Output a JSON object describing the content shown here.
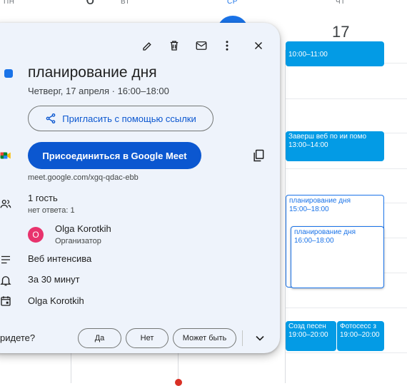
{
  "calendar": {
    "day_headers": [
      "ПН",
      "ВТ",
      "СР",
      "ЧТ"
    ],
    "day_number_partial": "6",
    "day_number": "17",
    "events": [
      {
        "title": "",
        "time": "10:00–11:00",
        "style": "solid"
      },
      {
        "title": "Заверш веб по ии помо",
        "time": "13:00–14:00",
        "style": "solid"
      },
      {
        "title": "планирование дня",
        "time": "15:00–18:00",
        "style": "outline"
      },
      {
        "title": "планирование дня",
        "time": "16:00–18:00",
        "style": "outline"
      },
      {
        "title": "Созд песен",
        "time": "19:00–20:00",
        "style": "solid"
      },
      {
        "title": "Фотосесс з",
        "time": "19:00–20:00",
        "style": "solid"
      }
    ]
  },
  "popup": {
    "toolbar_icons": [
      "edit-icon",
      "delete-icon",
      "email-icon",
      "more-icon",
      "close-icon"
    ],
    "event_color": "#1a73e8",
    "title": "планирование дня",
    "datetime": "Четверг, 17 апреля · 16:00–18:00",
    "invite_label": "Пригласить с помощью ссылки",
    "meet_label": "Присоединиться в Google Meet",
    "meet_link": "meet.google.com/xgq-qdac-ebb",
    "guests_count": "1 гость",
    "guests_status": "нет ответа: 1",
    "organizer_initial": "O",
    "organizer_name": "Olga Korotkih",
    "organizer_role": "Организатор",
    "description": "Веб интенсива",
    "reminder": "За 30 минут",
    "calendar_owner": "Olga Korotkih",
    "rsvp_question": "ридете?",
    "rsvp_yes": "Да",
    "rsvp_no": "Нет",
    "rsvp_maybe": "Может быть"
  }
}
